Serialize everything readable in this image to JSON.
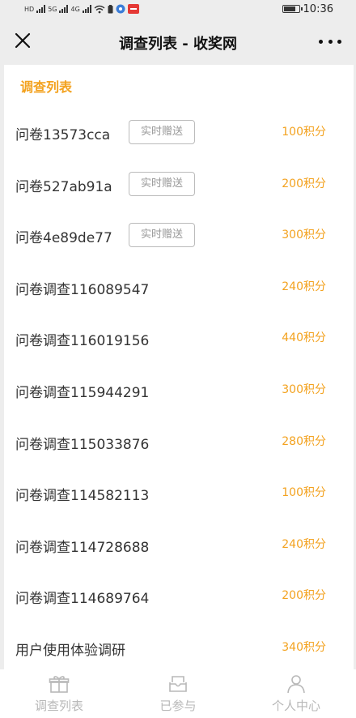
{
  "status_bar": {
    "time": "10:36",
    "left_labels": [
      "HD",
      "5G",
      "4G"
    ]
  },
  "nav": {
    "title": "调查列表 - 收奖网",
    "close_icon": "close-icon",
    "more_icon": "more-icon"
  },
  "section": {
    "title": "调查列表"
  },
  "items": [
    {
      "name": "问卷13573cca",
      "tag": "实时赠送",
      "points": "100积分"
    },
    {
      "name": "问卷527ab91a",
      "tag": "实时赠送",
      "points": "200积分"
    },
    {
      "name": "问卷4e89de77",
      "tag": "实时赠送",
      "points": "300积分"
    },
    {
      "name": "问卷调查116089547",
      "tag": "",
      "points": "240积分"
    },
    {
      "name": "问卷调查116019156",
      "tag": "",
      "points": "440积分"
    },
    {
      "name": "问卷调查115944291",
      "tag": "",
      "points": "300积分"
    },
    {
      "name": "问卷调查115033876",
      "tag": "",
      "points": "280积分"
    },
    {
      "name": "问卷调查114582113",
      "tag": "",
      "points": "100积分"
    },
    {
      "name": "问卷调查114728688",
      "tag": "",
      "points": "240积分"
    },
    {
      "name": "问卷调查114689764",
      "tag": "",
      "points": "200积分"
    },
    {
      "name": "用户使用体验调研",
      "tag": "",
      "points": "340积分"
    }
  ],
  "tabs": [
    {
      "label": "调查列表",
      "icon": "gift-icon"
    },
    {
      "label": "已参与",
      "icon": "inbox-icon"
    },
    {
      "label": "个人中心",
      "icon": "user-icon"
    }
  ],
  "colors": {
    "accent": "#f3a21f",
    "tab_inactive": "#b8b8b8",
    "background": "#ededed"
  }
}
